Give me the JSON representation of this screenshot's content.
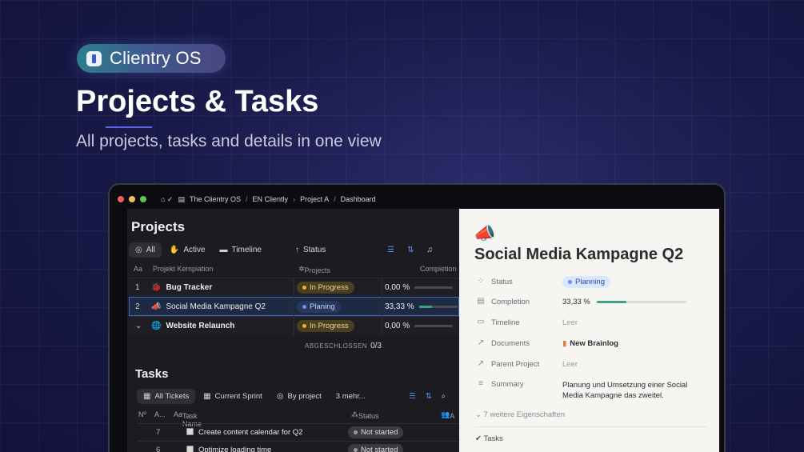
{
  "brand": {
    "name": "Clientry OS"
  },
  "hero": {
    "title": "Projects & Tasks",
    "subtitle": "All projects, tasks and details in one view"
  },
  "window": {
    "breadcrumbs": [
      "The Clientry OS",
      "EN Cliently",
      "Project A",
      "Dashboard"
    ]
  },
  "projects": {
    "heading": "Projects",
    "views": [
      "All",
      "Active",
      "Timeline"
    ],
    "sort_label": "Status",
    "columns": {
      "name": "Projekt Kempiation",
      "projects": "Projects",
      "completion": "Compietion"
    },
    "rows": [
      {
        "num": "1",
        "icon": "bug-icon",
        "name": "Bug Tracker",
        "status": "In Progress",
        "pct": "0,00 %",
        "progress": 0
      },
      {
        "num": "2",
        "icon": "megaphone-icon",
        "name": "Social Media Kampagne Q2",
        "status": "Planing",
        "pct": "33,33 %",
        "progress": 0.3333
      },
      {
        "num": "",
        "icon": "globe-icon",
        "name": "Website Relaunch",
        "status": "In Progress",
        "pct": "0,00 %",
        "progress": 0
      }
    ],
    "summary_label": "ABGESCHLOSSEN",
    "summary_value": "0/3"
  },
  "tasks": {
    "heading": "Tasks",
    "tabs": [
      "All Tickets",
      "Current Sprint",
      "By project",
      "3 mehr..."
    ],
    "columns": {
      "num": "Nº",
      "a": "A...",
      "name": "Task Name",
      "status": "Status",
      "assignee": "A"
    },
    "rows": [
      {
        "num": "7",
        "name": "Create content calendar for Q2",
        "status": "Not started"
      },
      {
        "num": "6",
        "name": "Optimize loading time",
        "status": "Not started"
      }
    ]
  },
  "detail": {
    "title": "Social Media Kampagne Q2",
    "props": {
      "status_label": "Status",
      "status_value": "Planning",
      "completion_label": "Completion",
      "completion_value": "33,33 %",
      "completion_progress": 0.3333,
      "timeline_label": "Timeline",
      "timeline_value": "Leer",
      "documents_label": "Documents",
      "documents_value": "New Brainlog",
      "parent_label": "Parent Project",
      "parent_value": "Leer",
      "summary_label": "Summary",
      "summary_value": "Planung und Umsetzung einer Social Media Kampagne das zweitel."
    },
    "more_label": "7 weitere Eigenschaften",
    "tasks_label": "Tasks"
  },
  "colors": {
    "accent": "#5b63e6",
    "planning": "#6d8df5",
    "in_progress": "#e7b43a",
    "progress_bar": "#3fa08a"
  }
}
